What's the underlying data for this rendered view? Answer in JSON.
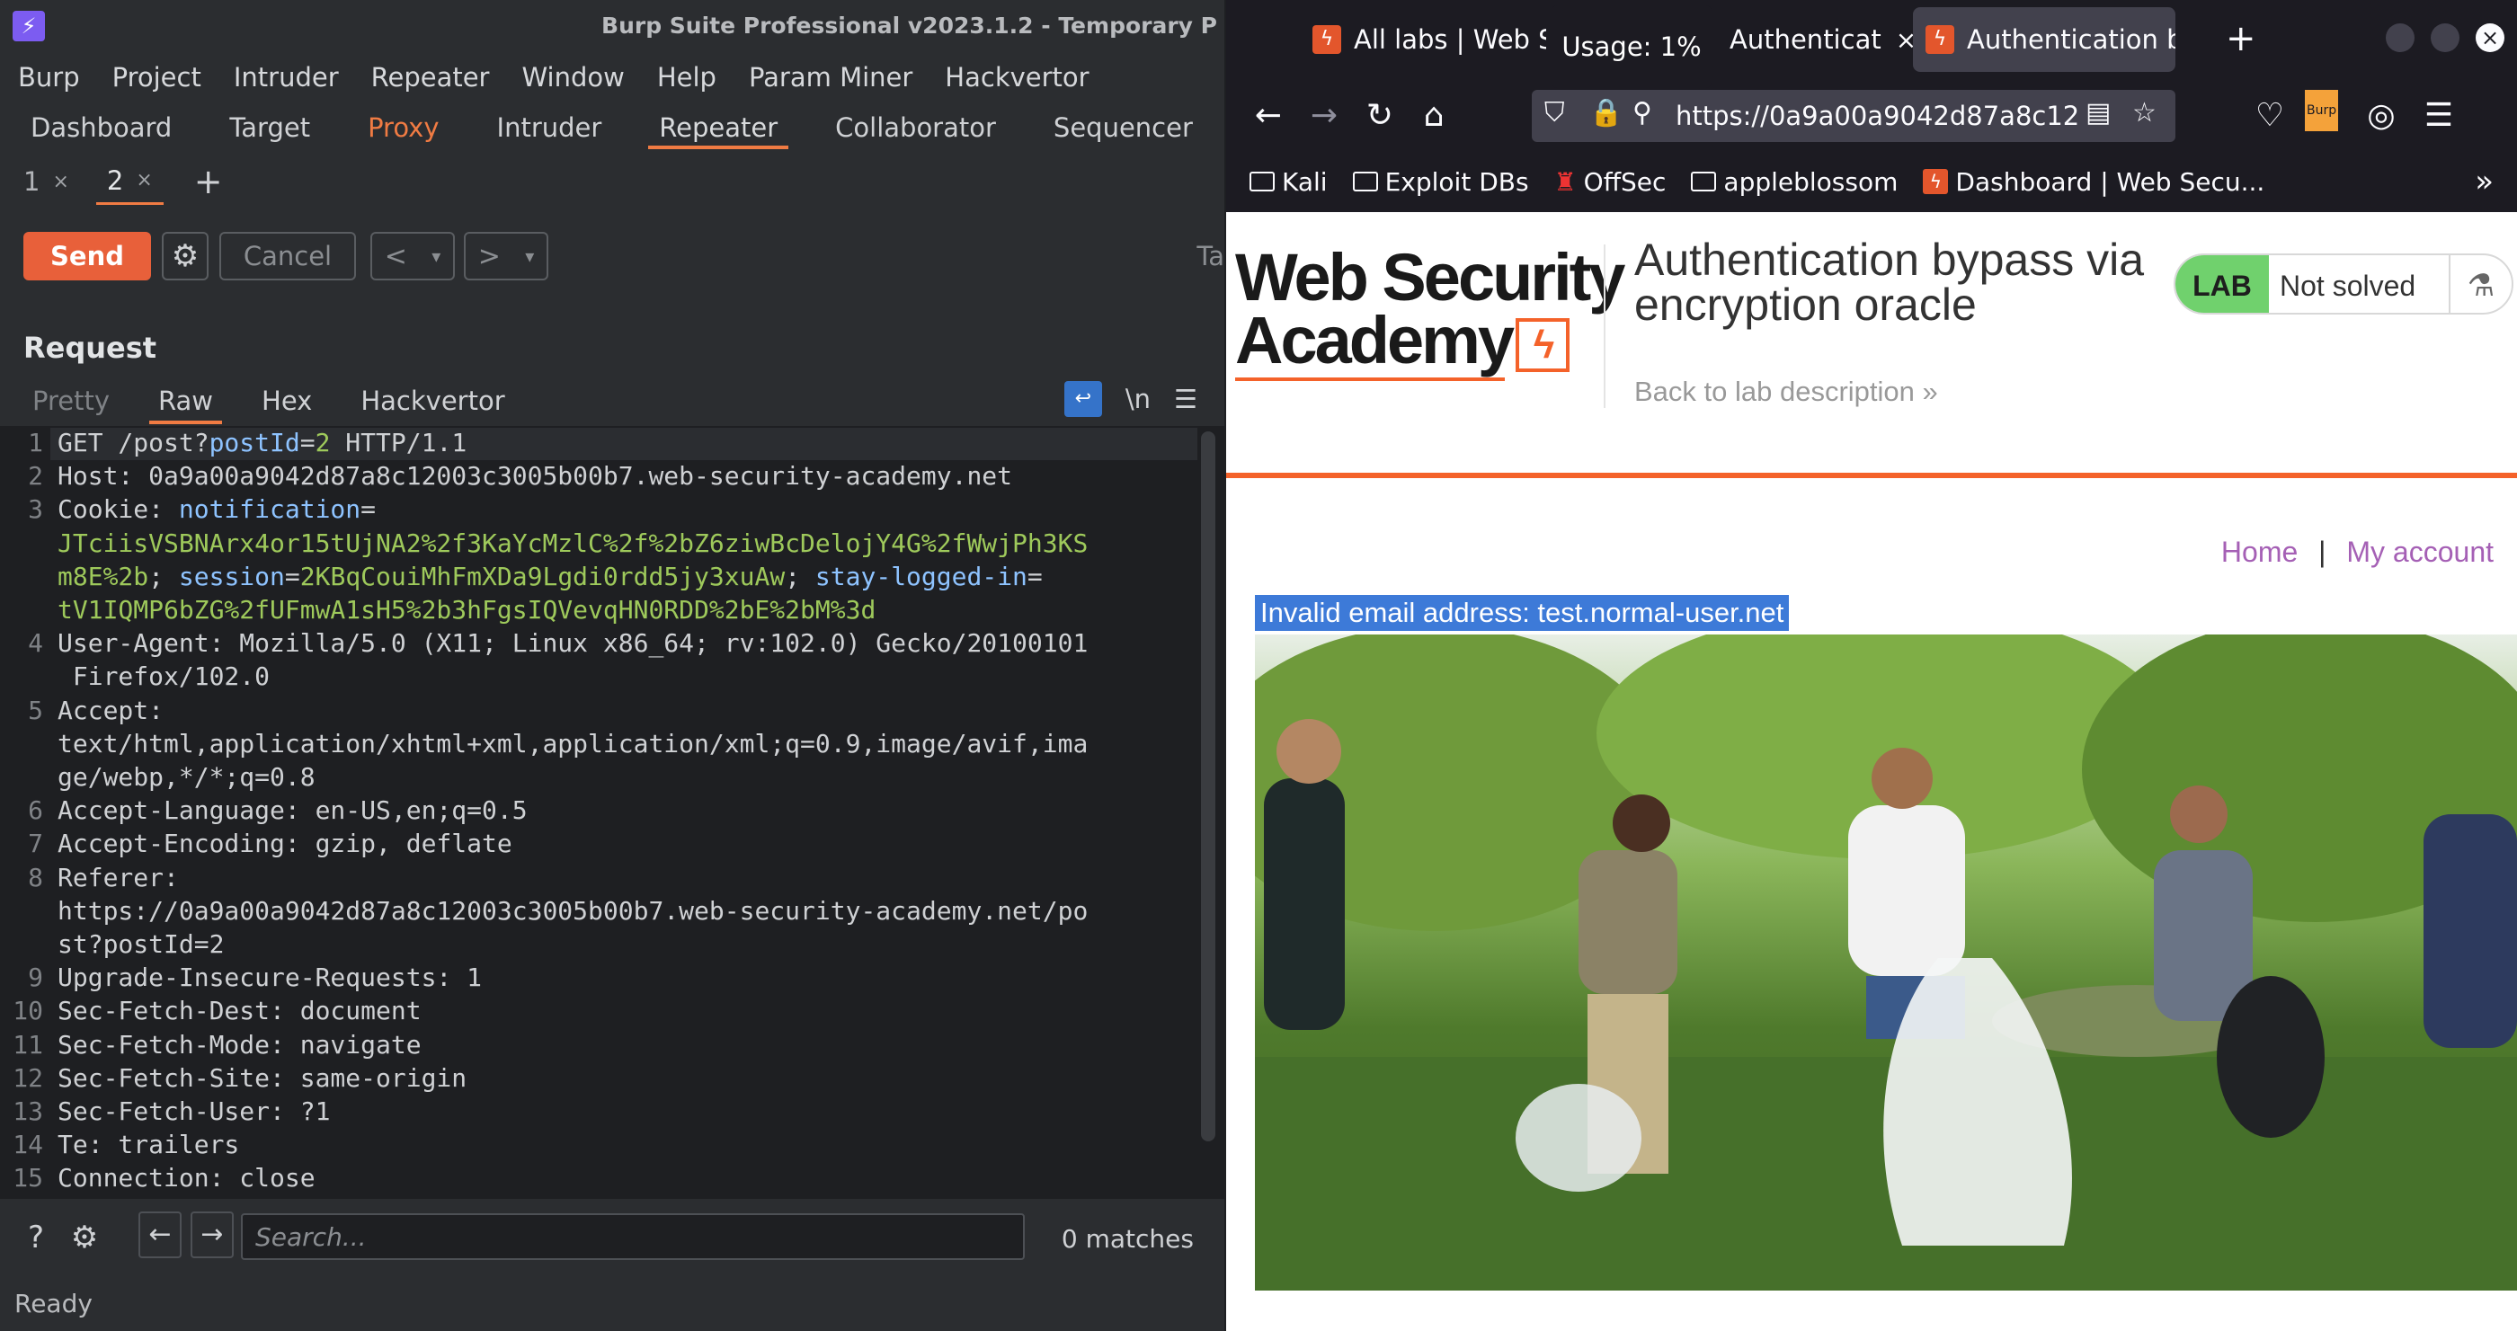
{
  "burp": {
    "window_title": "Burp Suite Professional v2023.1.2 - Temporary P",
    "menu": [
      "Burp",
      "Project",
      "Intruder",
      "Repeater",
      "Window",
      "Help",
      "Param Miner",
      "Hackvertor"
    ],
    "tabs": [
      "Dashboard",
      "Target",
      "Proxy",
      "Intruder",
      "Repeater",
      "Collaborator",
      "Sequencer"
    ],
    "subtabs": [
      {
        "label": "1",
        "close": "×"
      },
      {
        "label": "2",
        "close": "×"
      }
    ],
    "new_tab": "+",
    "send_label": "Send",
    "cancel_label": "Cancel",
    "target_cut": "Ta",
    "request_title": "Request",
    "request_tabs": [
      "Pretty",
      "Raw",
      "Hex",
      "Hackvertor"
    ],
    "newline_toggle": "\\n",
    "lines": [
      {
        "n": "1",
        "segs": [
          [
            "k",
            "GET /post?"
          ],
          [
            "p",
            "postId"
          ],
          [
            "k",
            "="
          ],
          [
            "v",
            "2"
          ],
          [
            "k",
            " HTTP/1.1"
          ]
        ]
      },
      {
        "n": "2",
        "segs": [
          [
            "k",
            "Host: 0a9a00a9042d87a8c12003c3005b00b7.web-security-academy.net"
          ]
        ]
      },
      {
        "n": "3",
        "segs": [
          [
            "k",
            "Cookie: "
          ],
          [
            "p",
            "notification"
          ],
          [
            "k",
            "="
          ]
        ]
      },
      {
        "n": "",
        "segs": [
          [
            "g",
            "JTciisVSBNArx4or15tUjNA2%2f3KaYcMzlC%2f%2bZ6ziwBcDelojY4G%2fWwjPh3KS"
          ]
        ]
      },
      {
        "n": "",
        "segs": [
          [
            "g",
            "m8E%2b"
          ],
          [
            "k",
            "; "
          ],
          [
            "p",
            "session"
          ],
          [
            "k",
            "="
          ],
          [
            "g",
            "2KBqCouiMhFmXDa9Lgdi0rdd5jy3xuAw"
          ],
          [
            "k",
            "; "
          ],
          [
            "p",
            "stay-logged-in"
          ],
          [
            "k",
            "="
          ]
        ]
      },
      {
        "n": "",
        "segs": [
          [
            "g",
            "tV1IQMP6bZG%2fUFmwA1sH5%2b3hFgsIQVevqHN0RDD%2bE%2bM%3d"
          ]
        ]
      },
      {
        "n": "4",
        "segs": [
          [
            "k",
            "User-Agent: Mozilla/5.0 (X11; Linux x86_64; rv:102.0) Gecko/20100101"
          ]
        ]
      },
      {
        "n": "",
        "segs": [
          [
            "k",
            " Firefox/102.0"
          ]
        ]
      },
      {
        "n": "5",
        "segs": [
          [
            "k",
            "Accept: "
          ]
        ]
      },
      {
        "n": "",
        "segs": [
          [
            "k",
            "text/html,application/xhtml+xml,application/xml;q=0.9,image/avif,ima"
          ]
        ]
      },
      {
        "n": "",
        "segs": [
          [
            "k",
            "ge/webp,*/*;q=0.8"
          ]
        ]
      },
      {
        "n": "6",
        "segs": [
          [
            "k",
            "Accept-Language: en-US,en;q=0.5"
          ]
        ]
      },
      {
        "n": "7",
        "segs": [
          [
            "k",
            "Accept-Encoding: gzip, deflate"
          ]
        ]
      },
      {
        "n": "8",
        "segs": [
          [
            "k",
            "Referer: "
          ]
        ]
      },
      {
        "n": "",
        "segs": [
          [
            "k",
            "https://0a9a00a9042d87a8c12003c3005b00b7.web-security-academy.net/po"
          ]
        ]
      },
      {
        "n": "",
        "segs": [
          [
            "k",
            "st?postId=2"
          ]
        ]
      },
      {
        "n": "9",
        "segs": [
          [
            "k",
            "Upgrade-Insecure-Requests: 1"
          ]
        ]
      },
      {
        "n": "10",
        "segs": [
          [
            "k",
            "Sec-Fetch-Dest: document"
          ]
        ]
      },
      {
        "n": "11",
        "segs": [
          [
            "k",
            "Sec-Fetch-Mode: navigate"
          ]
        ]
      },
      {
        "n": "12",
        "segs": [
          [
            "k",
            "Sec-Fetch-Site: same-origin"
          ]
        ]
      },
      {
        "n": "13",
        "segs": [
          [
            "k",
            "Sec-Fetch-User: ?1"
          ]
        ]
      },
      {
        "n": "14",
        "segs": [
          [
            "k",
            "Te: trailers"
          ]
        ]
      },
      {
        "n": "15",
        "segs": [
          [
            "k",
            "Connection: close"
          ]
        ]
      }
    ],
    "search_placeholder": "Search...",
    "matches": "0 matches",
    "status": "Ready"
  },
  "firefox": {
    "tabs": [
      {
        "label": "All labs | Web Se",
        "close": "×"
      },
      {
        "label": "Authenticat",
        "close": "×"
      },
      {
        "label": "Authentication b",
        "close": "×"
      }
    ],
    "usage": "Usage: 1%",
    "url": "https://0a9a00a9042d87a8c12",
    "bookmarks": [
      "Kali",
      "Exploit DBs",
      "OffSec",
      "appleblossom",
      "Dashboard | Web Secu..."
    ],
    "burp_badge": "Burp"
  },
  "page": {
    "logo_line1": "Web Security",
    "logo_line2": "Academy",
    "lab_title": "Authentication bypass via encryption oracle",
    "back_link": "Back to lab description",
    "lab_badge": "LAB",
    "lab_status": "Not solved",
    "nav_home": "Home",
    "nav_sep": "|",
    "nav_account": "My account",
    "error_message": "Invalid email address: test.normal-user.net"
  }
}
